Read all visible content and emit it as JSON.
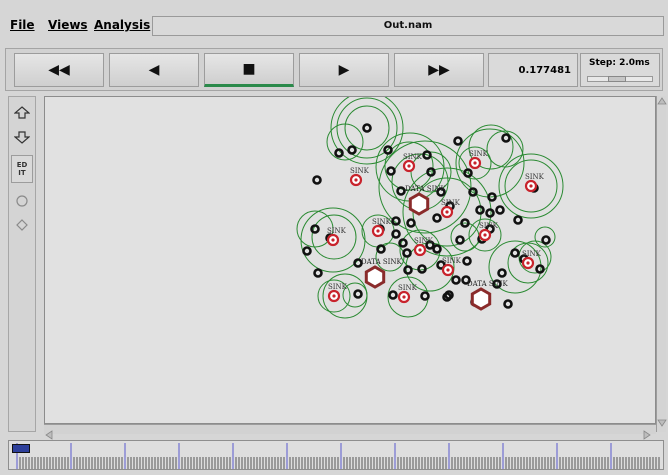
{
  "menu": {
    "file": "File",
    "views": "Views",
    "analysis": "Analysis"
  },
  "window": {
    "title": "Out.nam"
  },
  "transport": {
    "rewind": "◀◀",
    "back": "◀",
    "stop": "■",
    "play": "▶",
    "fastforward": "▶▶",
    "time": "0.177481",
    "step_label": "Step: 2.0ms"
  },
  "tools": {
    "edit": "ED\nIT"
  },
  "network": {
    "sink_label": "SINK",
    "data_sink_label": "DATA SINK",
    "colors": {
      "ring": "#2a8a32",
      "node": "#111111",
      "sink": "#c8232c",
      "hexagon": "#8a2b2b"
    }
  }
}
